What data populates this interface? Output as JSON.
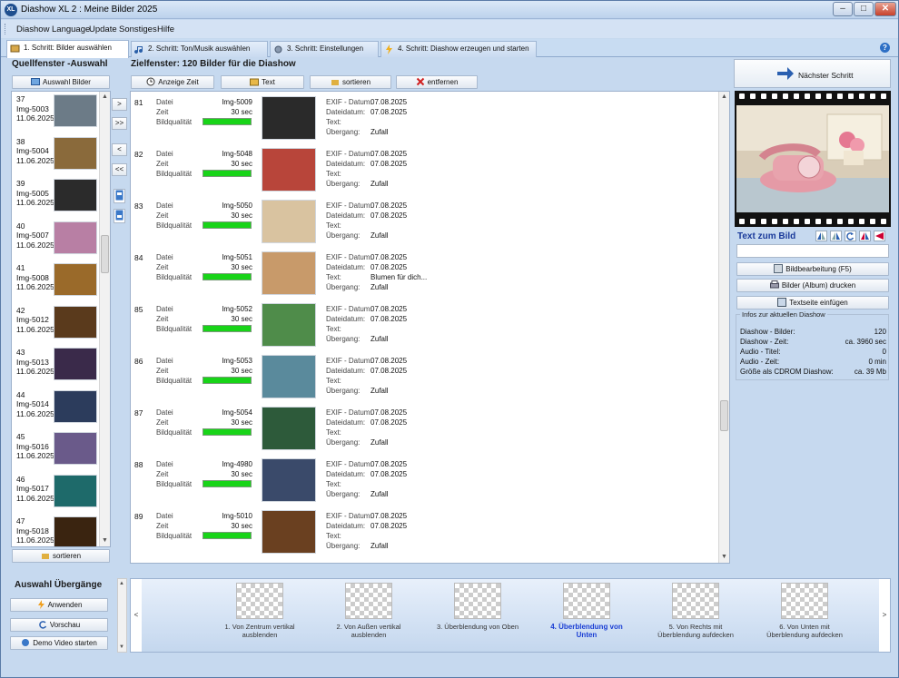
{
  "window": {
    "title": "Diashow XL 2 : Meine Bilder 2025"
  },
  "menu": [
    "Diashow",
    "Language",
    "Update",
    "Sonstiges",
    "Hilfe"
  ],
  "tabs": [
    {
      "label": "1. Schritt: Bilder auswählen",
      "active": true
    },
    {
      "label": "2. Schritt: Ton/Musik auswählen"
    },
    {
      "label": "3. Schritt: Einstellungen"
    },
    {
      "label": "4. Schritt: Diashow erzeugen und starten"
    }
  ],
  "source": {
    "title": "Quellfenster -Auswahl",
    "select_button": "Auswahl Bilder",
    "sort_button": "sortieren",
    "items": [
      {
        "num": "37",
        "name": "Img-5003",
        "date": "11.06.2025",
        "color": "#6c7b87"
      },
      {
        "num": "38",
        "name": "Img-5004",
        "date": "11.06.2025",
        "color": "#8a6a3b"
      },
      {
        "num": "39",
        "name": "Img-5005",
        "date": "11.06.2025",
        "color": "#2b2b2b"
      },
      {
        "num": "40",
        "name": "Img-5007",
        "date": "11.06.2025",
        "color": "#b87fa4"
      },
      {
        "num": "41",
        "name": "Img-5008",
        "date": "11.06.2025",
        "color": "#9a6a2a"
      },
      {
        "num": "42",
        "name": "Img-5012",
        "date": "11.06.2025",
        "color": "#5a3a1c"
      },
      {
        "num": "43",
        "name": "Img-5013",
        "date": "11.06.2025",
        "color": "#3a2a4a"
      },
      {
        "num": "44",
        "name": "Img-5014",
        "date": "11.06.2025",
        "color": "#2c3c5c"
      },
      {
        "num": "45",
        "name": "Img-5016",
        "date": "11.06.2025",
        "color": "#6a5a8a"
      },
      {
        "num": "46",
        "name": "Img-5017",
        "date": "11.06.2025",
        "color": "#1e6a6a"
      },
      {
        "num": "47",
        "name": "Img-5018",
        "date": "11.06.2025",
        "color": "#3a2410"
      }
    ]
  },
  "middle_buttons": [
    ">",
    ">>",
    "<",
    "<<"
  ],
  "target": {
    "title": "Zielfenster: 120 Bilder für die Diashow",
    "buttons": {
      "time": "Anzeige Zeit",
      "text": "Text",
      "sort": "sortieren",
      "remove": "entfernen"
    },
    "labels": {
      "file": "Datei",
      "time": "Zeit",
      "quality": "Bildqualität",
      "exif": "EXIF - Datum:",
      "filedate": "Dateidatum:",
      "text": "Text:",
      "transition": "Übergang:"
    },
    "rows": [
      {
        "num": "81",
        "file": "Img-5009",
        "time": "30 sec",
        "exif": "07.08.2025",
        "filedate": "07.08.2025",
        "text": "",
        "transition": "Zufall",
        "quality": 1.0,
        "color": "#2a2a2a"
      },
      {
        "num": "82",
        "file": "Img-5048",
        "time": "30 sec",
        "exif": "07.08.2025",
        "filedate": "07.08.2025",
        "text": "",
        "transition": "Zufall",
        "quality": 1.0,
        "color": "#b8453a"
      },
      {
        "num": "83",
        "file": "Img-5050",
        "time": "30 sec",
        "exif": "07.08.2025",
        "filedate": "07.08.2025",
        "text": "",
        "transition": "Zufall",
        "quality": 1.0,
        "color": "#d9c3a0"
      },
      {
        "num": "84",
        "file": "Img-5051",
        "time": "30 sec",
        "exif": "07.08.2025",
        "filedate": "07.08.2025",
        "text": "Blumen für dich...",
        "transition": "Zufall",
        "quality": 1.0,
        "color": "#c89a6a"
      },
      {
        "num": "85",
        "file": "Img-5052",
        "time": "30 sec",
        "exif": "07.08.2025",
        "filedate": "07.08.2025",
        "text": "",
        "transition": "Zufall",
        "quality": 1.0,
        "color": "#4f8c4a"
      },
      {
        "num": "86",
        "file": "Img-5053",
        "time": "30 sec",
        "exif": "07.08.2025",
        "filedate": "07.08.2025",
        "text": "",
        "transition": "Zufall",
        "quality": 1.0,
        "color": "#5a8a9c"
      },
      {
        "num": "87",
        "file": "Img-5054",
        "time": "30 sec",
        "exif": "07.08.2025",
        "filedate": "07.08.2025",
        "text": "",
        "transition": "Zufall",
        "quality": 1.0,
        "color": "#2d5a3a"
      },
      {
        "num": "88",
        "file": "Img-4980",
        "time": "30 sec",
        "exif": "07.08.2025",
        "filedate": "07.08.2025",
        "text": "",
        "transition": "Zufall",
        "quality": 1.0,
        "color": "#3a4a6a"
      },
      {
        "num": "89",
        "file": "Img-5010",
        "time": "30 sec",
        "exif": "07.08.2025",
        "filedate": "07.08.2025",
        "text": "",
        "transition": "Zufall",
        "quality": 1.0,
        "color": "#6a4020"
      }
    ]
  },
  "right": {
    "next_button": "Nächster Schritt",
    "text_title": "Text zum Bild",
    "text_value": "",
    "buttons": [
      "Bildbearbeitung (F5)",
      "Bilder (Album) drucken",
      "Textseite einfügen"
    ],
    "info": {
      "title": "Infos zur aktuellen Diashow",
      "rows": [
        {
          "label": "Diashow - Bilder:",
          "value": "120"
        },
        {
          "label": "Diashow - Zeit:",
          "value": "ca. 3960 sec"
        },
        {
          "label": "Audio - Titel:",
          "value": "0"
        },
        {
          "label": "Audio - Zeit:",
          "value": "0 min"
        },
        {
          "label": "Größe als CDROM Diashow:",
          "value": "ca. 39 Mb"
        }
      ]
    }
  },
  "transitions": {
    "title": "Auswahl Übergänge",
    "buttons": [
      "Anwenden",
      "Vorschau",
      "Demo Video starten"
    ],
    "items": [
      {
        "label": "1. Von Zentrum vertikal ausblenden"
      },
      {
        "label": "2. Von Außen vertikal ausblenden"
      },
      {
        "label": "3. Überblendung von Oben"
      },
      {
        "label": "4. Überblendung von Unten",
        "selected": true
      },
      {
        "label": "5. Von Rechts mit Überblendung aufdecken"
      },
      {
        "label": "6. Von Unten mit Überblendung aufdecken"
      }
    ],
    "nav_prev": "<",
    "nav_next": ">"
  },
  "colors": {
    "accent": "#1a3ed4",
    "quality_bar": "#18d418"
  }
}
